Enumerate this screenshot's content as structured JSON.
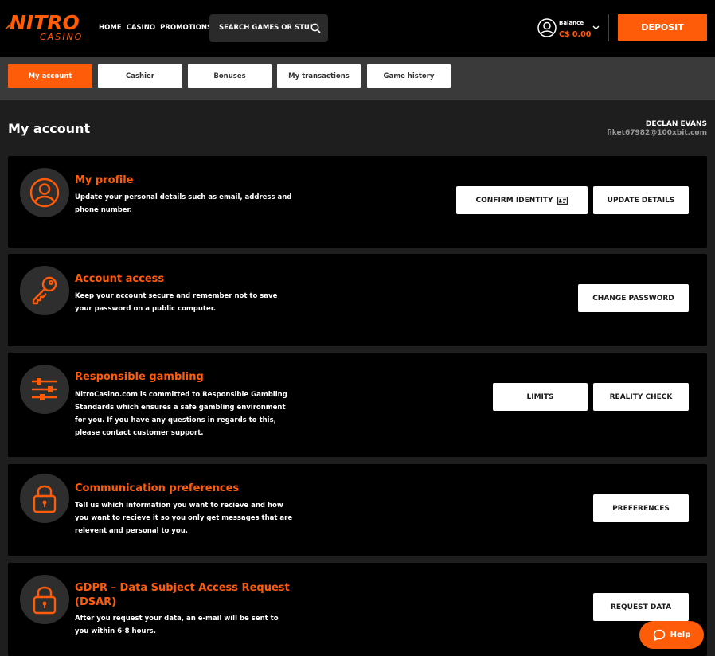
{
  "brand": {
    "name": "NITRO",
    "sub": "CASINO"
  },
  "nav": {
    "home": "HOME",
    "casino": "CASINO",
    "promotions": "PROMOTIONS"
  },
  "search": {
    "placeholder": "SEARCH GAMES OR STUDIOS"
  },
  "balance": {
    "label": "Balance",
    "value": "C$ 0.00"
  },
  "deposit_label": "DEPOSIT",
  "tabs": [
    "My account",
    "Cashier",
    "Bonuses",
    "My transactions",
    "Game history"
  ],
  "page": {
    "title": "My account",
    "user_name": "DECLAN EVANS",
    "user_email": "fiket67982@100xbit.com"
  },
  "cards": [
    {
      "title": "My profile",
      "desc": [
        "Update your personal details such as email, address and",
        "phone number."
      ],
      "buttons": [
        "CONFIRM IDENTITY",
        "UPDATE DETAILS"
      ]
    },
    {
      "title": "Account access",
      "desc": [
        "Keep your account secure and remember not to save",
        "your password on a public computer."
      ],
      "buttons": [
        "CHANGE PASSWORD"
      ]
    },
    {
      "title": "Responsible gambling",
      "desc": [
        "NitroCasino.com is committed to Responsible Gambling",
        "Standards which ensures a safe gambling environment",
        "for you. If you have any questions in regards to this,",
        "please contact customer support."
      ],
      "buttons": [
        "LIMITS",
        "REALITY CHECK"
      ]
    },
    {
      "title": "Communication preferences",
      "desc": [
        "Tell us which information you want to recieve and how",
        "you want to recieve it so you only get messages that are",
        "relevent and personal to you."
      ],
      "buttons": [
        "PREFERENCES"
      ]
    },
    {
      "title": [
        "GDPR – Data Subject Access Request",
        "(DSAR)"
      ],
      "desc": [
        "After you request your data, an e-mail will be sent to",
        "you within 6-8 hours."
      ],
      "buttons": [
        "REQUEST DATA"
      ]
    }
  ],
  "help_label": "Help",
  "colors": {
    "accent": "#ff5c0a",
    "card_bg": "#000000",
    "page_bg": "#1e1e1e"
  }
}
